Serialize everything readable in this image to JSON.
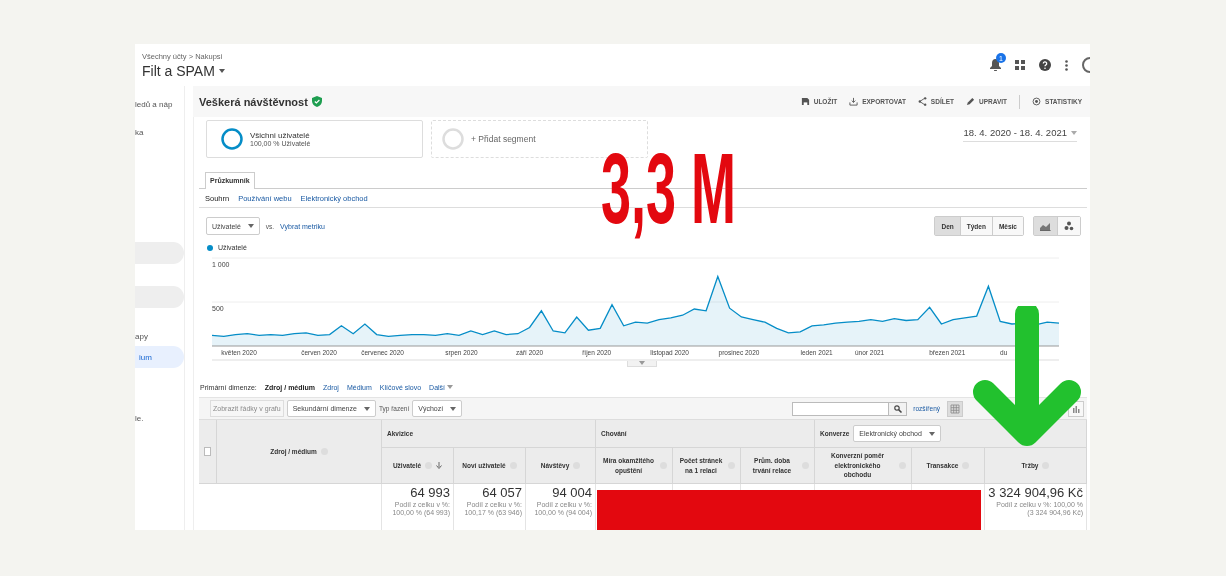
{
  "account": {
    "breadcrumb": "Všechny účty > Nakupsi",
    "property": "Filt a SPAM",
    "notifications": "1"
  },
  "sidebar": {
    "items": [
      {
        "kind": "text",
        "label": "ledů a náp",
        "selected": false
      },
      {
        "kind": "text",
        "label": "ka",
        "selected": false
      },
      {
        "kind": "pill",
        "selected": false
      },
      {
        "kind": "pill",
        "selected": false
      },
      {
        "kind": "text",
        "label": "apy",
        "selected": false
      },
      {
        "kind": "text",
        "label": "ium",
        "selected": true
      },
      {
        "kind": "text",
        "label": "le.",
        "selected": false
      }
    ]
  },
  "report": {
    "title": "Veškerá návštěvnost",
    "actions": [
      {
        "kind": "save",
        "label": "ULOŽIT"
      },
      {
        "kind": "export",
        "label": "EXPORTOVAT"
      },
      {
        "kind": "share",
        "label": "SDÍLET"
      },
      {
        "kind": "edit",
        "label": "UPRAVIT"
      },
      {
        "kind": "insights",
        "label": "STATISTIKY"
      }
    ]
  },
  "segments": [
    {
      "kind": "active",
      "name": "Všichni uživatelé",
      "detail": "100,00 % Uživatelé"
    },
    {
      "kind": "add",
      "name": "+ Přidat segment"
    }
  ],
  "date_range": "18. 4. 2020 - 18. 4. 2021",
  "tabs": [
    {
      "label": "Průzkumník",
      "selected": true
    }
  ],
  "subtabs": [
    {
      "label": "Souhrn",
      "selected": true
    },
    {
      "label": "Používání webu",
      "selected": false
    },
    {
      "label": "Elektronický obchod",
      "selected": false
    }
  ],
  "metric": {
    "value": "Uživatelé",
    "vs": "vs.",
    "link": "Vybrat metriku"
  },
  "periods": [
    {
      "label": "Den",
      "selected": true
    },
    {
      "label": "Týden",
      "selected": false
    },
    {
      "label": "Měsíc",
      "selected": false
    }
  ],
  "chart_modes": [
    {
      "kind": "line",
      "selected": true
    },
    {
      "kind": "motion",
      "selected": false
    }
  ],
  "chart": {
    "month_labels": [
      "květen 2020",
      "červen 2020",
      "červenec 2020",
      "srpen 2020",
      "září 2020",
      "říjen 2020",
      "listopad 2020",
      "prosinec 2020",
      "leden 2021",
      "únor 2021",
      "březen 2021",
      "du"
    ],
    "chart_data": {
      "type": "area",
      "ylim": [
        0,
        1000
      ],
      "yticks": [
        {
          "value": 500,
          "label": "500"
        },
        {
          "value": 1000,
          "label": "1 000"
        }
      ],
      "series": [
        {
          "name": "Uživatelé",
          "color": "#058dc7",
          "values": [
            120,
            110,
            130,
            140,
            120,
            130,
            120,
            140,
            150,
            120,
            130,
            230,
            140,
            250,
            130,
            110,
            120,
            130,
            130,
            120,
            140,
            120,
            170,
            130,
            170,
            130,
            140,
            210,
            400,
            170,
            150,
            330,
            180,
            200,
            470,
            230,
            270,
            260,
            300,
            320,
            350,
            420,
            400,
            790,
            430,
            330,
            300,
            270,
            200,
            150,
            160,
            230,
            240,
            260,
            270,
            280,
            300,
            280,
            310,
            290,
            300,
            440,
            250,
            300,
            320,
            340,
            680,
            280,
            250,
            260,
            240,
            270,
            260
          ]
        }
      ]
    }
  },
  "dimensions": {
    "label": "Primární dimenze:",
    "options": [
      {
        "kind": "option",
        "label": "Zdroj / médium",
        "selected": true
      },
      {
        "kind": "option",
        "label": "Zdroj",
        "selected": false
      },
      {
        "kind": "option",
        "label": "Médium",
        "selected": false
      },
      {
        "kind": "option",
        "label": "Klíčové slovo",
        "selected": false
      },
      {
        "kind": "menu",
        "label": "Další",
        "selected": false
      }
    ]
  },
  "table_toolbar": {
    "plot_rows": {
      "label": "Zobrazit řádky v grafu",
      "disabled": true
    },
    "secondary": "Sekundární dimenze",
    "sort_label": "Typ řazení",
    "sort": "Výchozí",
    "advanced": "rozšířený",
    "views": [
      {
        "kind": "table",
        "selected": true
      },
      {
        "kind": "bars",
        "selected": false
      }
    ]
  },
  "table": {
    "select_all": {
      "checked": false
    },
    "dimension": "Zdroj / médium",
    "groups": [
      {
        "label": "Akvizice"
      },
      {
        "label": "Chování"
      },
      {
        "label": "Konverze",
        "select": "Elektronický obchod"
      }
    ],
    "columns": [
      {
        "label": "Uživatelé",
        "sorted": true,
        "total": "64 993",
        "share_label": "Podíl z celku v %:",
        "share": "100,00 % (64 993)"
      },
      {
        "label": "Noví uživatelé",
        "sorted": false,
        "total": "64 057",
        "share_label": "Podíl z celku v %:",
        "share": "100,17 % (63 946)"
      },
      {
        "label": "Návštěvy",
        "sorted": false,
        "total": "94 004",
        "share_label": "Podíl z celku v %:",
        "share": "100,00 % (94 004)"
      },
      {
        "label": "Míra okamžitého opuštění",
        "sorted": false
      },
      {
        "label": "Počet stránek na 1 relaci",
        "sorted": false
      },
      {
        "label": "Prům. doba trvání relace",
        "sorted": false
      },
      {
        "label": "Konverzní poměr elektronického obchodu",
        "sorted": false
      },
      {
        "label": "Transakce",
        "sorted": false
      },
      {
        "label": "Tržby",
        "sorted": false,
        "total": "3 324 904,96 Kč",
        "share_label": "Podíl z celku v %: 100,00 %",
        "share": "(3 324 904,96 Kč)"
      }
    ]
  },
  "overlay": {
    "headline": "3,3 M"
  }
}
